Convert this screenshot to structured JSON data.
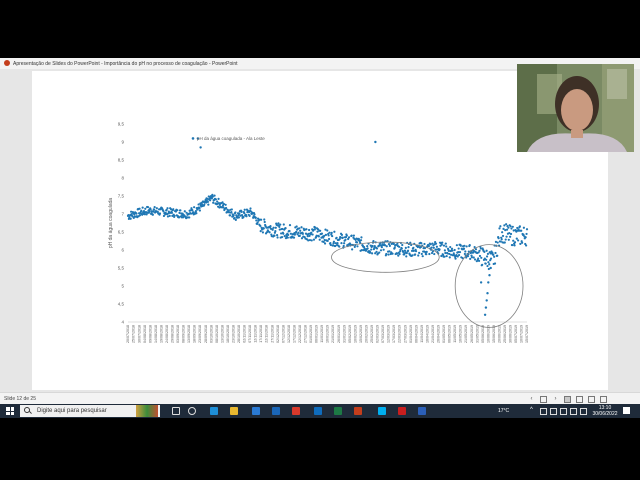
{
  "window": {
    "title": "Apresentação de Slides do PowerPoint - Importância do pH no processo de coagulação - PowerPoint",
    "app_icon": "powerpoint-icon"
  },
  "statusbar": {
    "slide_indicator": "Slide 12 de 25",
    "icons": [
      "chevron-left-icon",
      "notes-icon",
      "chevron-right-icon",
      "normal-view-icon",
      "slide-sorter-icon",
      "reading-view-icon",
      "slideshow-icon"
    ]
  },
  "taskbar": {
    "search_placeholder": "Digite aqui para pesquisar",
    "weather": "17°C",
    "time": "13:10",
    "date": "30/06/2022",
    "apps": [
      {
        "name": "task-view-icon",
        "color": "#1f2b3a"
      },
      {
        "name": "cortana-icon",
        "color": "#1f2b3a"
      },
      {
        "name": "edge-icon",
        "color": "#1e8fd8"
      },
      {
        "name": "file-explorer-icon",
        "color": "#e8b830"
      },
      {
        "name": "store-icon",
        "color": "#2a7ad4"
      },
      {
        "name": "mail-icon",
        "color": "#1a66b8"
      },
      {
        "name": "chrome-icon",
        "color": "#d8392b"
      },
      {
        "name": "outlook-icon",
        "color": "#0f6cbd"
      },
      {
        "name": "excel-icon",
        "color": "#1d7a45"
      },
      {
        "name": "powerpoint-icon",
        "color": "#c43e1c"
      },
      {
        "name": "skype-icon",
        "color": "#00aff0"
      },
      {
        "name": "acrobat-icon",
        "color": "#c81e1e"
      },
      {
        "name": "word-icon",
        "color": "#2b5fb8"
      }
    ]
  },
  "colors": {
    "marker": "#1f77b4",
    "taskbar": "#1f2b3a"
  },
  "chart_data": {
    "type": "scatter",
    "legend": "pH da água coagulada - Ala Leste",
    "legend_position": "top-left",
    "ylabel": "pH da água coagulada",
    "ylim": [
      4,
      9.5
    ],
    "yticks": [
      "4",
      "4,5",
      "5",
      "5,5",
      "6",
      "6,5",
      "7",
      "7,5",
      "8",
      "8,5",
      "9",
      "9,5"
    ],
    "xticks": [
      "20/07/2018",
      "25/07/2018",
      "30/07/2018",
      "04/08/2018",
      "09/08/2018",
      "14/08/2018",
      "19/08/2018",
      "24/08/2018",
      "29/08/2018",
      "03/09/2018",
      "08/09/2018",
      "13/09/2018",
      "18/09/2018",
      "23/09/2018",
      "28/09/2018",
      "03/10/2018",
      "08/10/2018",
      "13/10/2018",
      "18/10/2018",
      "23/10/2018",
      "28/10/2018",
      "02/11/2018",
      "07/11/2018",
      "12/11/2018",
      "17/11/2018",
      "22/11/2018",
      "27/11/2018",
      "02/12/2018",
      "07/12/2018",
      "12/12/2018",
      "17/12/2018",
      "22/12/2018",
      "27/12/2018",
      "01/01/2019",
      "06/01/2019",
      "11/01/2019",
      "16/01/2019",
      "21/01/2019",
      "26/01/2019",
      "31/01/2019",
      "05/02/2019",
      "10/02/2019",
      "15/02/2019",
      "20/02/2019",
      "25/02/2019",
      "02/03/2019",
      "07/03/2019",
      "12/03/2019",
      "17/03/2019",
      "22/03/2019",
      "27/03/2019",
      "01/04/2019",
      "06/04/2019",
      "11/04/2019",
      "16/04/2019",
      "21/04/2019",
      "26/04/2019",
      "01/05/2019",
      "06/05/2019",
      "11/05/2019",
      "16/05/2019",
      "21/05/2019",
      "26/05/2019",
      "31/05/2019",
      "05/06/2019",
      "10/06/2019",
      "15/06/2019",
      "20/06/2019",
      "25/06/2019",
      "30/06/2019",
      "05/07/2019",
      "10/07/2019",
      "15/07/2019"
    ],
    "trend": [
      {
        "x": 0.0,
        "y": 6.95
      },
      {
        "x": 0.05,
        "y": 7.1
      },
      {
        "x": 0.1,
        "y": 7.05
      },
      {
        "x": 0.15,
        "y": 7.0
      },
      {
        "x": 0.19,
        "y": 7.25
      },
      {
        "x": 0.21,
        "y": 7.45
      },
      {
        "x": 0.24,
        "y": 7.2
      },
      {
        "x": 0.27,
        "y": 6.95
      },
      {
        "x": 0.31,
        "y": 7.05
      },
      {
        "x": 0.33,
        "y": 6.7
      },
      {
        "x": 0.37,
        "y": 6.55
      },
      {
        "x": 0.42,
        "y": 6.5
      },
      {
        "x": 0.47,
        "y": 6.45
      },
      {
        "x": 0.52,
        "y": 6.3
      },
      {
        "x": 0.57,
        "y": 6.2
      },
      {
        "x": 0.62,
        "y": 6.05
      },
      {
        "x": 0.67,
        "y": 6.05
      },
      {
        "x": 0.72,
        "y": 6.0
      },
      {
        "x": 0.77,
        "y": 6.05
      },
      {
        "x": 0.82,
        "y": 5.95
      },
      {
        "x": 0.86,
        "y": 5.95
      },
      {
        "x": 0.89,
        "y": 5.8
      },
      {
        "x": 0.915,
        "y": 5.7
      },
      {
        "x": 0.935,
        "y": 6.5
      },
      {
        "x": 0.96,
        "y": 6.4
      },
      {
        "x": 1.0,
        "y": 6.4
      }
    ],
    "outliers": [
      {
        "x": 0.175,
        "y": 9.1
      },
      {
        "x": 0.182,
        "y": 8.85
      },
      {
        "x": 0.62,
        "y": 9.0
      },
      {
        "x": 0.895,
        "y": 4.2
      },
      {
        "x": 0.897,
        "y": 4.4
      },
      {
        "x": 0.899,
        "y": 4.6
      },
      {
        "x": 0.901,
        "y": 4.8
      },
      {
        "x": 0.903,
        "y": 5.1
      },
      {
        "x": 0.906,
        "y": 5.3
      },
      {
        "x": 0.909,
        "y": 5.5
      },
      {
        "x": 0.885,
        "y": 5.1
      }
    ],
    "annotations": [
      {
        "type": "ellipse",
        "cx": 0.645,
        "cy": 5.8,
        "rx": 0.135,
        "ry": 0.42
      },
      {
        "type": "ellipse",
        "cx": 0.905,
        "cy": 5.0,
        "rx": 0.085,
        "ry": 1.15
      }
    ]
  }
}
